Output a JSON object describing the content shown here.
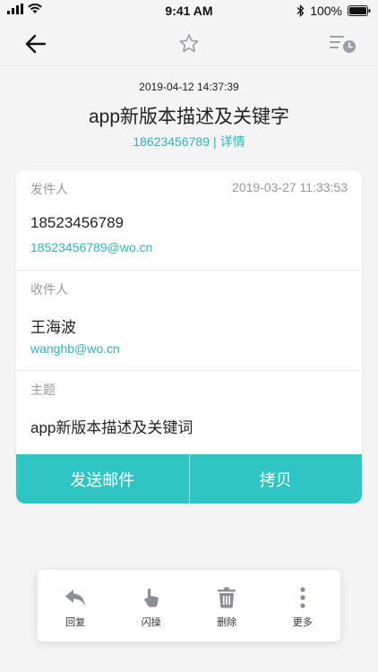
{
  "status_bar": {
    "time": "9:41 AM",
    "battery": "100%"
  },
  "header": {
    "date": "2019-04-12 14:37:39",
    "title": "app新版本描述及关键字",
    "phone": "18623456789",
    "separator": "|",
    "detail_link": "详情"
  },
  "sender": {
    "label": "发件人",
    "time": "2019-03-27 11:33:53",
    "number": "18523456789",
    "email": "18523456789@wo.cn"
  },
  "recipient": {
    "label": "收件人",
    "name": "王海波",
    "email": "wanghb@wo.cn"
  },
  "subject": {
    "label": "主题",
    "text": "app新版本描述及关键词"
  },
  "actions": {
    "send": "发送邮件",
    "copy": "拷贝"
  },
  "toolbar": {
    "items": [
      {
        "label": "回复",
        "icon": "reply-icon"
      },
      {
        "label": "闪操",
        "icon": "hand-tap-icon"
      },
      {
        "label": "删除",
        "icon": "trash-icon"
      },
      {
        "label": "更多",
        "icon": "more-vertical-icon"
      }
    ]
  },
  "colors": {
    "accent": "#30c5c5",
    "link": "#2ab7c7",
    "icon_gray": "#8a8f96"
  }
}
